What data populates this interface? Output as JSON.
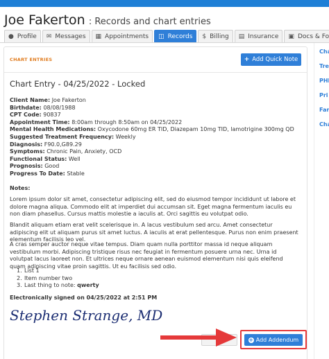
{
  "header": {
    "patient_name": "Joe Fakerton",
    "subtitle": ": Records and chart entries"
  },
  "tabs": [
    {
      "label": "Profile",
      "icon": "user-icon",
      "active": false
    },
    {
      "label": "Messages",
      "icon": "envelope-icon",
      "active": false
    },
    {
      "label": "Appointments",
      "icon": "calendar-icon",
      "active": false
    },
    {
      "label": "Records",
      "icon": "folder-icon",
      "active": true
    },
    {
      "label": "Billing",
      "icon": "dollar-icon",
      "active": false
    },
    {
      "label": "Insurance",
      "icon": "card-icon",
      "active": false
    },
    {
      "label": "Docs & Forms",
      "icon": "document-icon",
      "active": false
    }
  ],
  "section": {
    "label": "CHART ENTRIES",
    "add_quick_note": "Add Quick Note"
  },
  "entry": {
    "title": "Chart Entry - 04/25/2022 - Locked",
    "fields": [
      {
        "label": "Client Name:",
        "value": "Joe Fakerton"
      },
      {
        "label": "Birthdate:",
        "value": "08/08/1988"
      },
      {
        "label": "CPT Code:",
        "value": "90837"
      },
      {
        "label": "Appointment Time:",
        "value": "8:00am through 8:50am on 04/25/2022"
      },
      {
        "label": "Mental Health Medications:",
        "value": "Oxycodone 60mg ER TID, Diazepam 10mg TID, lamotrigine 300mg QD"
      },
      {
        "label": "Suggested Treatment Frequency:",
        "value": "Weekly"
      },
      {
        "label": "Diagnosis:",
        "value": "F90.0,G89.29"
      },
      {
        "label": "Symptoms:",
        "value": "Chronic Pain, Anxiety, OCD"
      },
      {
        "label": "Functional Status:",
        "value": "Well"
      },
      {
        "label": "Prognosis:",
        "value": "Good"
      },
      {
        "label": "Progress To Date:",
        "value": "Stable"
      }
    ],
    "notes_label": "Notes:",
    "paragraphs": [
      "Lorem ipsum dolor sit amet, consectetur adipiscing elit, sed do eiusmod tempor incididunt ut labore et dolore magna aliqua. Commodo elit at imperdiet dui accumsan sit. Eget magna fermentum iaculis eu non diam phasellus. Cursus mattis molestie a iaculis at. Orci sagittis eu volutpat odio.",
      "Blandit aliquam etiam erat velit scelerisque in. A lacus vestibulum sed arcu. Amet consectetur adipiscing elit ut aliquam purus sit amet luctus. A iaculis at erat pellentesque. Purus non enim praesent elementum facilisis leo vel.",
      "A cras semper auctor neque vitae tempus. Diam quam nulla porttitor massa id neque aliquam vestibulum morbi. Adipiscing tristique risus nec feugiat in fermentum posuere urna nec. Urna id volutpat lacus laoreet non. Et ultrices neque ornare aenean euismod elementum nisi quis eleifend quam adipiscing vitae proin sagittis. Ut eu facilisis sed odio."
    ],
    "list": [
      {
        "num": "1.",
        "text": "List 1",
        "bold": ""
      },
      {
        "num": "2.",
        "text": "Item number two",
        "bold": ""
      },
      {
        "num": "3.",
        "text": "Last thing to note: ",
        "bold": "qwerty"
      }
    ],
    "signed_text": "Electronically signed on 04/25/2022 at 2:51 PM",
    "signature": "Stephen Strange, MD",
    "add_addendum": "Add Addendum"
  },
  "right_nav": [
    "Cha",
    "Tre",
    "PHI",
    "Pri",
    "Fan",
    "Cha"
  ],
  "colors": {
    "accent": "#2f7fd8",
    "section_label": "#e07b1d",
    "highlight": "#e5393a",
    "signature": "#1b2d72"
  }
}
